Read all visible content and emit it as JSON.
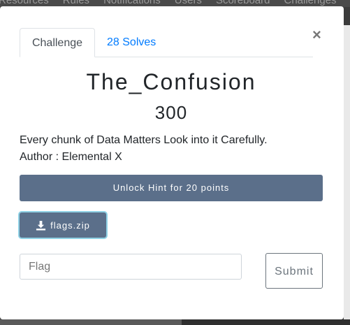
{
  "navbar": {
    "items": [
      "Resources",
      "Rules",
      "Notifications",
      "Users",
      "Scoreboard",
      "Challenges"
    ]
  },
  "modal": {
    "close_label": "×",
    "tabs": [
      {
        "label": "Challenge",
        "active": true
      },
      {
        "label": "28 Solves",
        "active": false
      }
    ],
    "title": "The_Confusion",
    "points": "300",
    "description": "Every chunk of Data Matters Look into it Carefully.",
    "author": "Author : Elemental X",
    "hint_button": "Unlock Hint for 20 points",
    "file_button": "flags.zip",
    "flag_placeholder": "Flag",
    "submit_label": "Submit"
  },
  "colors": {
    "button_bg": "#5b6f8a",
    "link": "#007bff",
    "focus_ring": "#8fd2e6"
  }
}
